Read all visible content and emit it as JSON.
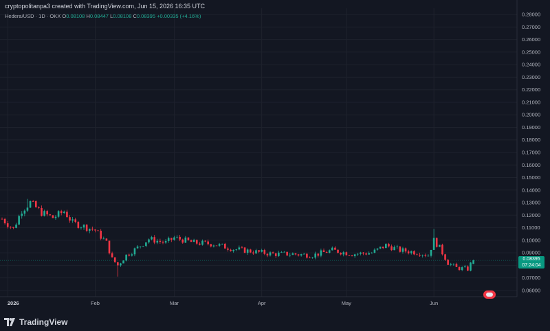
{
  "header": {
    "credit": "cryptopolitanpa3 created with TradingView.com, Jun 15, 2026 16:35 UTC",
    "symbol": "Hedera/USD · 1D · OKX",
    "o_label": "O",
    "o_value": "0.08108",
    "h_label": "H",
    "h_value": "0.08447",
    "l_label": "L",
    "l_value": "0.08108",
    "c_label": "C",
    "c_value": "0.08395",
    "change": "+0.00335 (+4.16%)"
  },
  "price_tag": {
    "price": "0.08395",
    "countdown": "07:24:04"
  },
  "footer": {
    "brand": "TradingView"
  },
  "colors": {
    "background": "#131722",
    "up": "#22ab94",
    "down": "#f23645",
    "grid": "#1e222d",
    "axis_text": "#b2b5be",
    "tag": "#089981"
  },
  "icons": {
    "logo": "tradingview-logo-icon",
    "event": "event-badge-icon"
  },
  "chart_data": {
    "type": "candlestick",
    "title": "",
    "ylim": [
      0.055,
      0.285
    ],
    "y_ticks": [
      0.06,
      0.07,
      0.08,
      0.09,
      0.1,
      0.11,
      0.12,
      0.13,
      0.14,
      0.15,
      0.16,
      0.17,
      0.18,
      0.19,
      0.2,
      0.21,
      0.22,
      0.23,
      0.24,
      0.25,
      0.26,
      0.27,
      0.28
    ],
    "y_tick_labels": [
      "0.06000",
      "0.07000",
      "0.08000",
      "0.09000",
      "0.10000",
      "0.11000",
      "0.12000",
      "0.13000",
      "0.14000",
      "0.15000",
      "0.16000",
      "0.17000",
      "0.18000",
      "0.19000",
      "0.20000",
      "0.21000",
      "0.22000",
      "0.23000",
      "0.24000",
      "0.25000",
      "0.26000",
      "0.27000",
      "0.28000"
    ],
    "x_ticks": [
      {
        "label": "2026",
        "date": "2026-01-01",
        "bold": true
      },
      {
        "label": "Feb",
        "date": "2026-02-01"
      },
      {
        "label": "Mar",
        "date": "2026-03-01"
      },
      {
        "label": "Apr",
        "date": "2026-04-01"
      },
      {
        "label": "May",
        "date": "2026-05-01"
      },
      {
        "label": "Jun",
        "date": "2026-06-01"
      }
    ],
    "xlim": [
      "2025-12-30",
      "2026-06-19"
    ],
    "current_price": 0.08395,
    "keypoints": [
      [
        "2025-12-30",
        0.117
      ],
      [
        "2026-01-03",
        0.109
      ],
      [
        "2026-01-06",
        0.124
      ],
      [
        "2026-01-09",
        0.13
      ],
      [
        "2026-01-13",
        0.122
      ],
      [
        "2026-01-17",
        0.118
      ],
      [
        "2026-01-21",
        0.123
      ],
      [
        "2026-01-24",
        0.114
      ],
      [
        "2026-01-28",
        0.111
      ],
      [
        "2026-02-01",
        0.108
      ],
      [
        "2026-02-05",
        0.098
      ],
      [
        "2026-02-07",
        0.085
      ],
      [
        "2026-02-09",
        0.08
      ],
      [
        "2026-02-12",
        0.088
      ],
      [
        "2026-02-16",
        0.094
      ],
      [
        "2026-02-20",
        0.101
      ],
      [
        "2026-02-26",
        0.098
      ],
      [
        "2026-03-01",
        0.102
      ],
      [
        "2026-03-08",
        0.098
      ],
      [
        "2026-03-15",
        0.097
      ],
      [
        "2026-03-22",
        0.093
      ],
      [
        "2026-03-29",
        0.091
      ],
      [
        "2026-04-05",
        0.089
      ],
      [
        "2026-04-12",
        0.089
      ],
      [
        "2026-04-19",
        0.088
      ],
      [
        "2026-04-26",
        0.092
      ],
      [
        "2026-05-03",
        0.089
      ],
      [
        "2026-05-10",
        0.09
      ],
      [
        "2026-05-15",
        0.096
      ],
      [
        "2026-05-20",
        0.092
      ],
      [
        "2026-05-27",
        0.09
      ],
      [
        "2026-05-30",
        0.088
      ],
      [
        "2026-06-01",
        0.1
      ],
      [
        "2026-06-03",
        0.094
      ],
      [
        "2026-06-06",
        0.082
      ],
      [
        "2026-06-09",
        0.078
      ],
      [
        "2026-06-13",
        0.077
      ],
      [
        "2026-06-14",
        0.081
      ],
      [
        "2026-06-15",
        0.084
      ]
    ],
    "spikes": [
      {
        "date": "2026-01-08",
        "high": 0.133
      },
      {
        "date": "2026-02-09",
        "low": 0.071
      },
      {
        "date": "2026-06-01",
        "high": 0.109
      }
    ]
  }
}
